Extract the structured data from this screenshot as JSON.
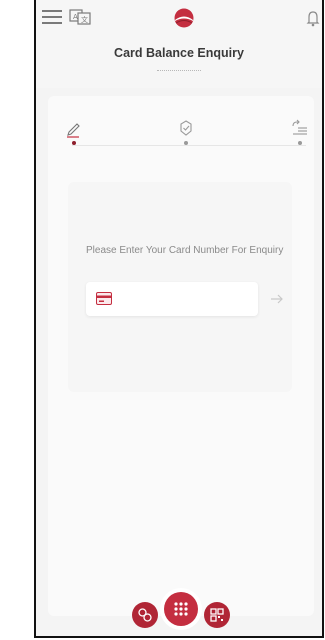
{
  "header": {
    "menu_icon": "hamburger-menu-icon",
    "language_icon": "translate-icon",
    "logo_icon": "bank-logo",
    "notification_icon": "bell-icon",
    "title": "Card Balance Enquiry"
  },
  "stepper": {
    "steps": [
      {
        "icon": "pencil-icon",
        "state": "active"
      },
      {
        "icon": "verify-check-icon",
        "state": "pending"
      },
      {
        "icon": "result-list-icon",
        "state": "pending"
      }
    ]
  },
  "form": {
    "prompt": "Please Enter Your Card Number For Enquiry",
    "card_input_value": "",
    "card_input_placeholder": "",
    "card_icon": "credit-card-icon",
    "submit_icon": "arrow-right-icon"
  },
  "bottom_nav": {
    "items": [
      {
        "icon": "transfer-icon"
      },
      {
        "icon": "apps-grid-icon"
      },
      {
        "icon": "qr-code-icon"
      }
    ]
  },
  "colors": {
    "accent": "#c42e40",
    "accent_dark": "#8e1f2c",
    "text_dark": "#3a3a3a",
    "text_muted": "#8a8a8a",
    "background": "#f4f4f4"
  }
}
